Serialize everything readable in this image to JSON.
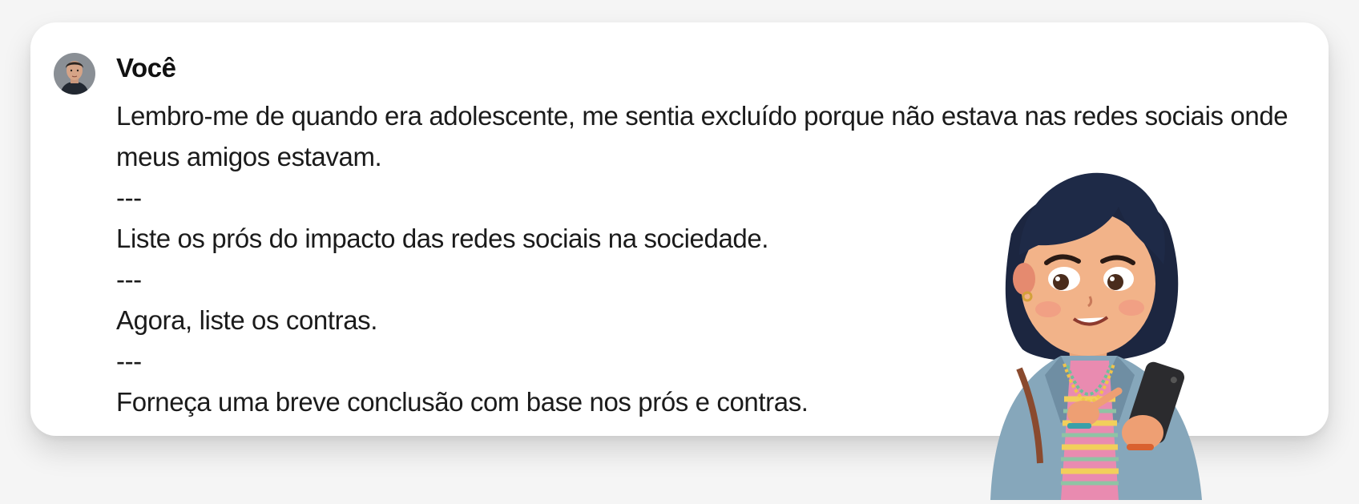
{
  "chat": {
    "author": "Você",
    "lines": [
      "Lembro-me de quando era adolescente, me sentia excluído porque não estava nas redes sociais onde meus amigos estavam.",
      "---",
      "Liste os prós do impacto das redes sociais na sociedade.",
      "---",
      "Agora, liste os contras.",
      "---",
      "Forneça uma breve conclusão com base nos prós e contras."
    ]
  },
  "colors": {
    "background": "#f5f5f5",
    "card": "#ffffff",
    "text": "#1b1b1b"
  },
  "icons": {
    "avatar": "user-photo-avatar",
    "mascot": "cartoon-girl-with-phone"
  }
}
